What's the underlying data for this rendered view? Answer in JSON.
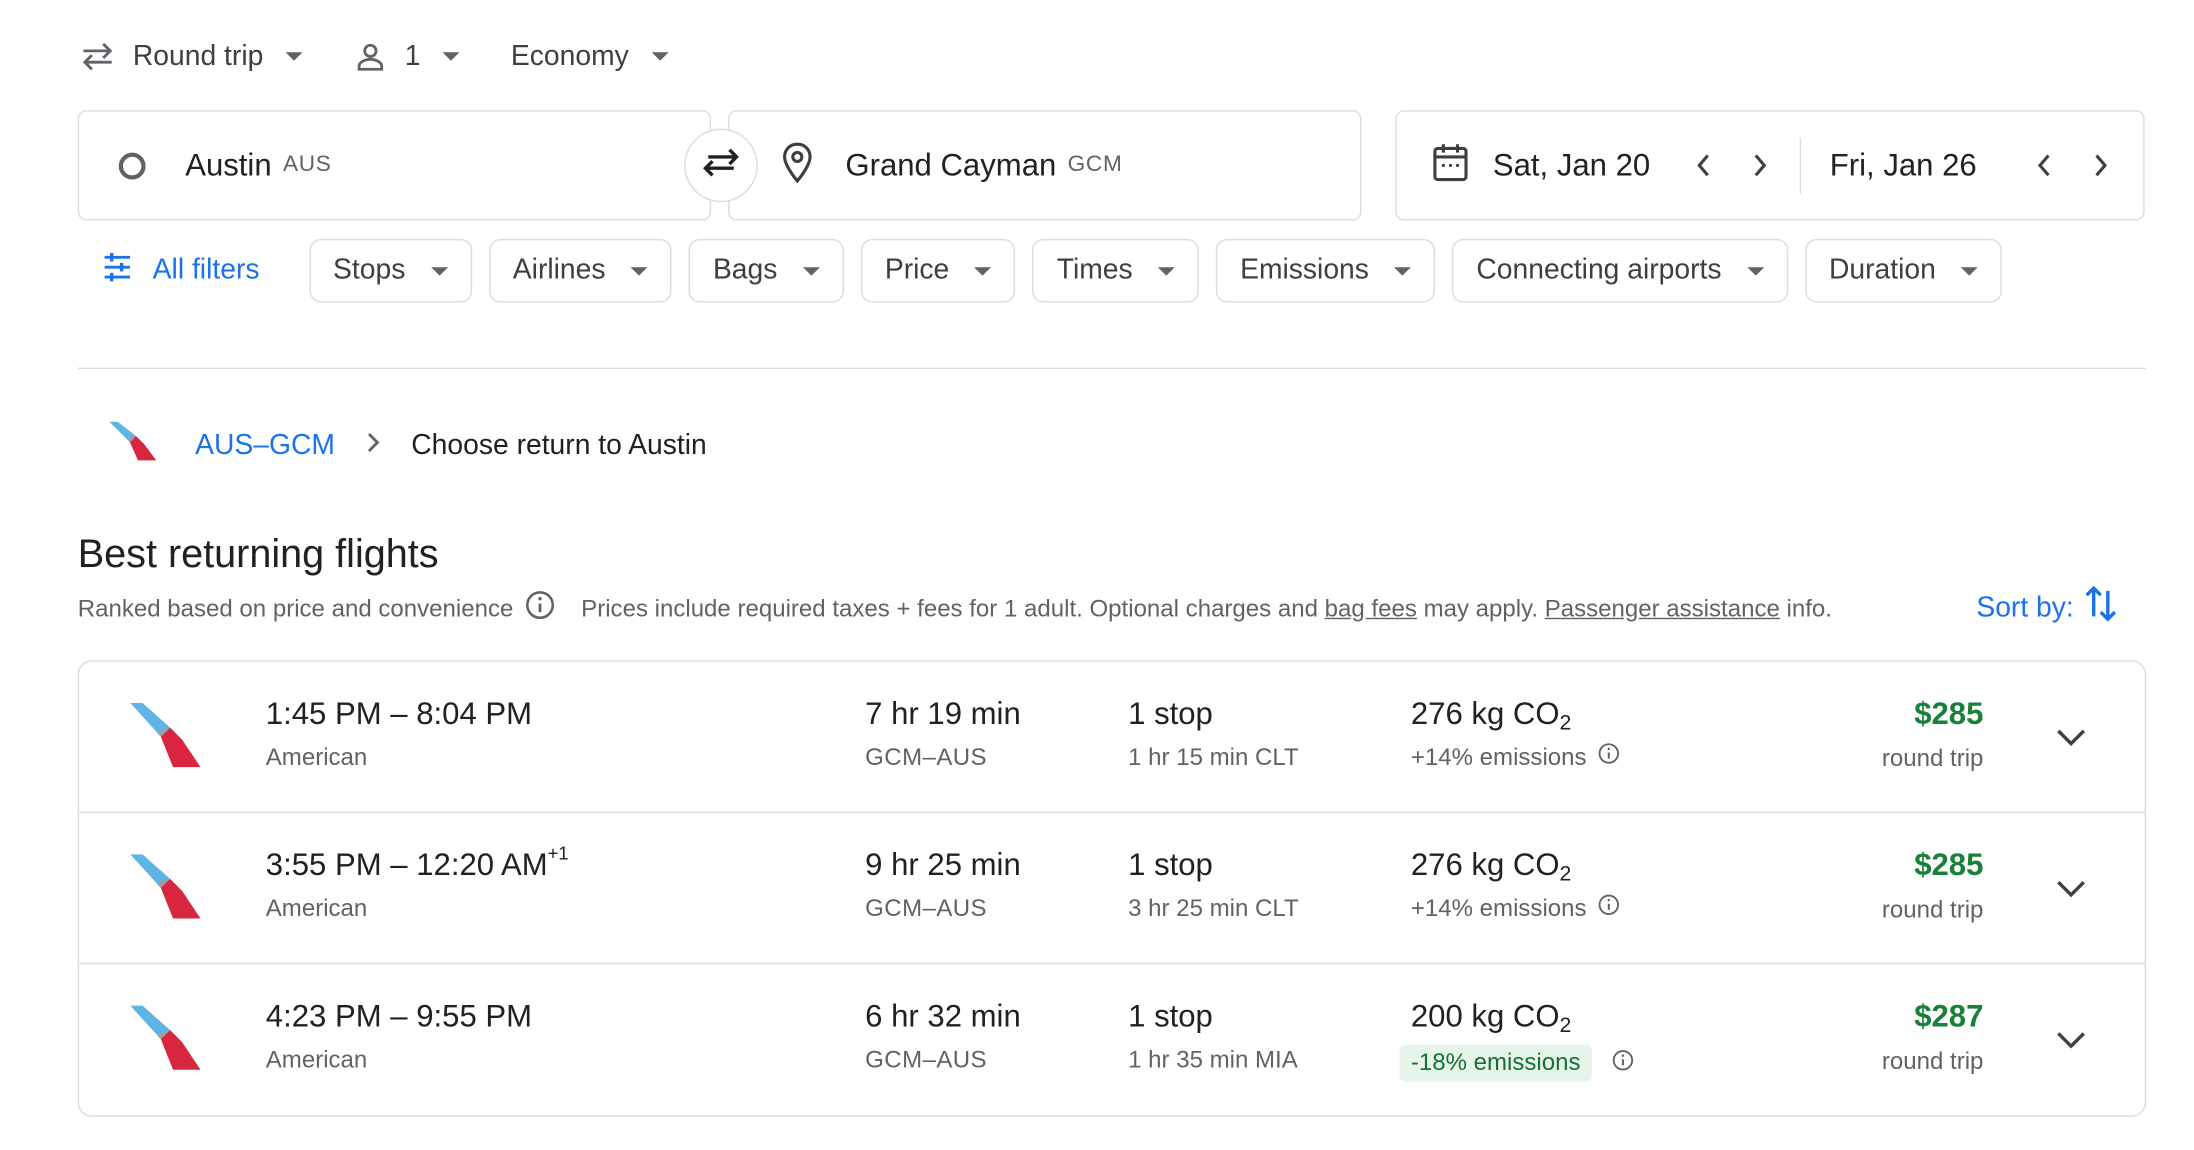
{
  "trip_options": {
    "trip_type": "Round trip",
    "passengers": "1",
    "cabin_class": "Economy"
  },
  "search": {
    "origin_city": "Austin",
    "origin_code": "AUS",
    "destination_city": "Grand Cayman",
    "destination_code": "GCM",
    "depart_date": "Sat, Jan 20",
    "return_date": "Fri, Jan 26"
  },
  "filters": {
    "all_filters": "All filters",
    "chips": [
      "Stops",
      "Airlines",
      "Bags",
      "Price",
      "Times",
      "Emissions",
      "Connecting airports",
      "Duration"
    ]
  },
  "breadcrumb": {
    "outbound": "AUS–GCM",
    "separator": ">",
    "current": "Choose return to Austin"
  },
  "section": {
    "title": "Best returning flights",
    "ranked": "Ranked based on price and convenience",
    "prices_prefix": "Prices include required taxes + fees for 1 adult. Optional charges and",
    "bag_fees": "bag fees",
    "may_apply": "may apply.",
    "passenger_assistance": "Passenger assistance",
    "info_suffix": "info.",
    "sort_by": "Sort by:"
  },
  "flights": [
    {
      "depart": "1:45 PM",
      "dash": "–",
      "arrive": "8:04 PM",
      "day_offset": "",
      "airline": "American",
      "duration": "7 hr 19 min",
      "route": "GCM–AUS",
      "stops": "1 stop",
      "layover": "1 hr 15 min CLT",
      "co2_value": "276 kg CO",
      "co2_sub": "2",
      "emissions": "+14% emissions",
      "emissions_good": false,
      "price": "$285",
      "price_type": "round trip"
    },
    {
      "depart": "3:55 PM",
      "dash": "–",
      "arrive": "12:20 AM",
      "day_offset": "+1",
      "airline": "American",
      "duration": "9 hr 25 min",
      "route": "GCM–AUS",
      "stops": "1 stop",
      "layover": "3 hr 25 min CLT",
      "co2_value": "276 kg CO",
      "co2_sub": "2",
      "emissions": "+14% emissions",
      "emissions_good": false,
      "price": "$285",
      "price_type": "round trip"
    },
    {
      "depart": "4:23 PM",
      "dash": "–",
      "arrive": "9:55 PM",
      "day_offset": "",
      "airline": "American",
      "duration": "6 hr 32 min",
      "route": "GCM–AUS",
      "stops": "1 stop",
      "layover": "1 hr 35 min MIA",
      "co2_value": "200 kg CO",
      "co2_sub": "2",
      "emissions": "-18% emissions",
      "emissions_good": true,
      "price": "$287",
      "price_type": "round trip"
    }
  ],
  "colors": {
    "accent": "#1a73e8",
    "price_green": "#188038",
    "emissions_good_bg": "#e6f4ea",
    "airline_red": "#d7263d",
    "airline_blue": "#5fb4e5"
  }
}
